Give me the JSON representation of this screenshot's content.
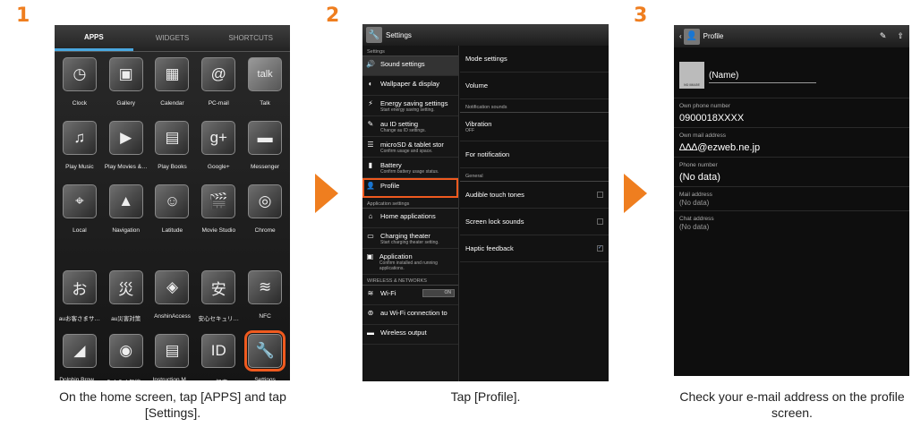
{
  "steps": {
    "one": "1",
    "two": "2",
    "three": "3"
  },
  "captions": {
    "one": "On the home screen, tap [APPS] and tap [Settings].",
    "two": "Tap [Profile].",
    "three": "Check your e-mail address on the profile screen."
  },
  "screen1": {
    "tabs": [
      "APPS",
      "WIDGETS",
      "SHORTCUTS"
    ],
    "apps": [
      {
        "label": "Clock",
        "glyph": "◷"
      },
      {
        "label": "Gallery",
        "glyph": "▣"
      },
      {
        "label": "Calendar",
        "glyph": "▦"
      },
      {
        "label": "PC-mail",
        "glyph": "@"
      },
      {
        "label": "Talk",
        "glyph": "talk"
      },
      {
        "label": "Play Music",
        "glyph": "♫"
      },
      {
        "label": "Play Movies &…",
        "glyph": "▶"
      },
      {
        "label": "Play Books",
        "glyph": "▤"
      },
      {
        "label": "Google+",
        "glyph": "g+"
      },
      {
        "label": "Messenger",
        "glyph": "▬"
      },
      {
        "label": "Local",
        "glyph": "⌖"
      },
      {
        "label": "Navigation",
        "glyph": "▲"
      },
      {
        "label": "Latitude",
        "glyph": "☺"
      },
      {
        "label": "Movie Studio",
        "glyph": "🎬"
      },
      {
        "label": "Chrome",
        "glyph": "◎"
      },
      {
        "label": "auお客さまサ…",
        "glyph": "お"
      },
      {
        "label": "au災害対策",
        "glyph": "災"
      },
      {
        "label": "AnshinAccess",
        "glyph": "◈"
      },
      {
        "label": "安心セキュリ…",
        "glyph": "安"
      },
      {
        "label": "NFC",
        "glyph": "≋"
      },
      {
        "label": "Dolphin Brow…",
        "glyph": "◢"
      },
      {
        "label": "らくらく無線…",
        "glyph": "◉"
      },
      {
        "label": "Instruction M…",
        "glyph": "▤"
      },
      {
        "label": "au設定",
        "glyph": "ID"
      },
      {
        "label": "Settings",
        "glyph": "🔧"
      }
    ]
  },
  "screen2": {
    "title": "Settings",
    "left": [
      {
        "type": "section",
        "text": "Settings"
      },
      {
        "type": "item",
        "glyph": "🔊",
        "title": "Sound settings",
        "sub": "",
        "sel": true
      },
      {
        "type": "item",
        "glyph": "◐",
        "title": "Wallpaper & display",
        "sub": ""
      },
      {
        "type": "item",
        "glyph": "⚡",
        "title": "Energy saving settings",
        "sub": "Start energy saving setting."
      },
      {
        "type": "item",
        "glyph": "✎",
        "title": "au ID setting",
        "sub": "Change au ID settings."
      },
      {
        "type": "item",
        "glyph": "☰",
        "title": "microSD & tablet stor",
        "sub": "Confirm usage and space."
      },
      {
        "type": "item",
        "glyph": "▮",
        "title": "Battery",
        "sub": "Confirm battery usage status."
      },
      {
        "type": "item",
        "glyph": "👤",
        "title": "Profile",
        "sub": "",
        "boxed": true
      },
      {
        "type": "section",
        "text": "Application settings"
      },
      {
        "type": "item",
        "glyph": "⌂",
        "title": "Home applications",
        "sub": ""
      },
      {
        "type": "item",
        "glyph": "▭",
        "title": "Charging theater",
        "sub": "Start charging theater setting."
      },
      {
        "type": "item",
        "glyph": "▣",
        "title": "Application",
        "sub": "Confirm installed and running applications."
      },
      {
        "type": "section",
        "text": "WIRELESS & NETWORKS"
      },
      {
        "type": "item",
        "glyph": "≋",
        "title": "Wi-Fi",
        "sub": "",
        "toggle": "ON"
      },
      {
        "type": "item",
        "glyph": "⊚",
        "title": "au Wi-Fi connection to",
        "sub": ""
      },
      {
        "type": "item",
        "glyph": "▬",
        "title": "Wireless output",
        "sub": ""
      }
    ],
    "right": [
      {
        "type": "item",
        "title": "Mode settings",
        "sub": ""
      },
      {
        "type": "item",
        "title": "Volume",
        "sub": ""
      },
      {
        "type": "section",
        "text": "Notification sounds"
      },
      {
        "type": "item",
        "title": "Vibration",
        "sub": "OFF"
      },
      {
        "type": "item",
        "title": "For notification",
        "sub": ""
      },
      {
        "type": "section",
        "text": "General"
      },
      {
        "type": "item",
        "title": "Audible touch tones",
        "sub": "",
        "check": ""
      },
      {
        "type": "item",
        "title": "Screen lock sounds",
        "sub": "",
        "check": ""
      },
      {
        "type": "item",
        "title": "Haptic feedback",
        "sub": "",
        "check": "✓"
      }
    ]
  },
  "screen3": {
    "title": "Profile",
    "no_image": "NO IMAGE",
    "name": "(Name)",
    "fields": [
      {
        "k": "Own phone number",
        "v": "0900018XXXX",
        "small": false
      },
      {
        "k": "Own mail address",
        "v": "∆∆∆@ezweb.ne.jp",
        "small": false
      },
      {
        "k": "Phone number",
        "v": "(No data)",
        "small": false
      },
      {
        "k": "Mail address",
        "v": "(No data)",
        "small": true
      },
      {
        "k": "Chat address",
        "v": "(No data)",
        "small": true
      }
    ]
  }
}
